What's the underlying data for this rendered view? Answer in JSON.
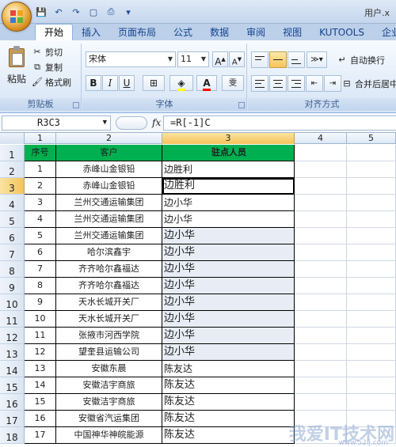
{
  "window": {
    "title": "用户.x"
  },
  "tabs": [
    "开始",
    "插入",
    "页面布局",
    "公式",
    "数据",
    "审阅",
    "视图",
    "KUTOOLS",
    "企业"
  ],
  "ribbon": {
    "clipboard": {
      "paste": "粘贴",
      "cut": "剪切",
      "copy": "复制",
      "format_painter": "格式刷",
      "label": "剪贴板"
    },
    "font": {
      "name": "宋体",
      "size": "11",
      "label": "字体"
    },
    "alignment": {
      "wrap": "自动换行",
      "merge": "合并后居中",
      "label": "对齐方式"
    }
  },
  "formula_bar": {
    "name_box": "R3C3",
    "fx": "fx",
    "formula": "=R[-1]C"
  },
  "columns": [
    "1",
    "2",
    "3",
    "4",
    "5"
  ],
  "table": {
    "header": {
      "no": "序号",
      "customer": "客户",
      "staff": "驻点人员"
    },
    "rows": [
      {
        "row": "2",
        "no": "1",
        "customer": "赤峰山金银铅",
        "staff": "边胜利"
      },
      {
        "row": "3",
        "no": "2",
        "customer": "赤峰山金银铅",
        "staff": "边胜利"
      },
      {
        "row": "4",
        "no": "3",
        "customer": "兰州交通运输集团",
        "staff": "边小华"
      },
      {
        "row": "5",
        "no": "4",
        "customer": "兰州交通运输集团",
        "staff": "边小华"
      },
      {
        "row": "6",
        "no": "5",
        "customer": "兰州交通运输集团",
        "staff": "边小华"
      },
      {
        "row": "7",
        "no": "6",
        "customer": "哈尔滨鑫宇",
        "staff": "边小华"
      },
      {
        "row": "8",
        "no": "7",
        "customer": "齐齐哈尔鑫福达",
        "staff": "边小华"
      },
      {
        "row": "9",
        "no": "8",
        "customer": "齐齐哈尔鑫福达",
        "staff": "边小华"
      },
      {
        "row": "10",
        "no": "9",
        "customer": "天水长城开关厂",
        "staff": "边小华"
      },
      {
        "row": "11",
        "no": "10",
        "customer": "天水长城开关厂",
        "staff": "边小华"
      },
      {
        "row": "12",
        "no": "11",
        "customer": "张掖市河西学院",
        "staff": "边小华"
      },
      {
        "row": "13",
        "no": "12",
        "customer": "望奎县运输公司",
        "staff": "边小华"
      },
      {
        "row": "14",
        "no": "13",
        "customer": "安徽东晨",
        "staff": "陈友达"
      },
      {
        "row": "15",
        "no": "14",
        "customer": "安徽洁宇商旅",
        "staff": "陈友达"
      },
      {
        "row": "16",
        "no": "15",
        "customer": "安徽洁宇商旅",
        "staff": "陈友达"
      },
      {
        "row": "17",
        "no": "16",
        "customer": "安徽省汽运集团",
        "staff": "陈友达"
      },
      {
        "row": "18",
        "no": "17",
        "customer": "中国神华神皖能源",
        "staff": "陈友达"
      }
    ]
  },
  "watermark": {
    "text": "我爱IT技术网",
    "url": "www.52ij.com"
  }
}
